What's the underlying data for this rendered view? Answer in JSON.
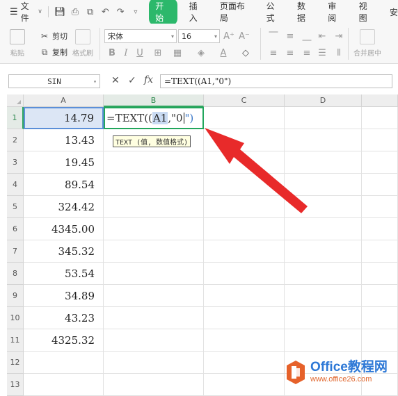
{
  "menubar": {
    "file_label": "文件",
    "tabs": [
      "开始",
      "插入",
      "页面布局",
      "公式",
      "数据",
      "审阅",
      "视图",
      "安"
    ],
    "active_tab": "开始",
    "accent_color": "#2cb86b"
  },
  "ribbon": {
    "paste_label": "粘贴",
    "cut_label": "剪切",
    "copy_label": "复制",
    "format_painter_label": "格式刷",
    "font_name": "宋体",
    "font_size": "16",
    "merge_label": "合并居中"
  },
  "formula_bar": {
    "name_box": "SIN",
    "cancel_icon": "close-icon",
    "enter_icon": "check-icon",
    "fx_label": "fx",
    "formula": "=TEXT((A1,\"0\")"
  },
  "sheet": {
    "columns": [
      "A",
      "B",
      "C",
      "D"
    ],
    "rows": [
      "1",
      "2",
      "3",
      "4",
      "5",
      "6",
      "7",
      "8",
      "9",
      "10",
      "11",
      "12",
      "13"
    ],
    "a_values": [
      "14.79",
      "13.43",
      "19.45",
      "89.54",
      "324.42",
      "4345.00",
      "345.32",
      "53.54",
      "34.89",
      "43.23",
      "4325.32"
    ],
    "b1_parts": {
      "prefix": "=TEXT((",
      "ref": "A1",
      "suffix": ",\"0",
      "close": "\")"
    },
    "tooltip": "TEXT (值, 数值格式)",
    "selection_color": "#22a65c"
  },
  "annotation": {
    "arrow_color": "#e82a2a"
  },
  "watermark": {
    "title": "Office教程网",
    "url": "www.office26.com"
  }
}
